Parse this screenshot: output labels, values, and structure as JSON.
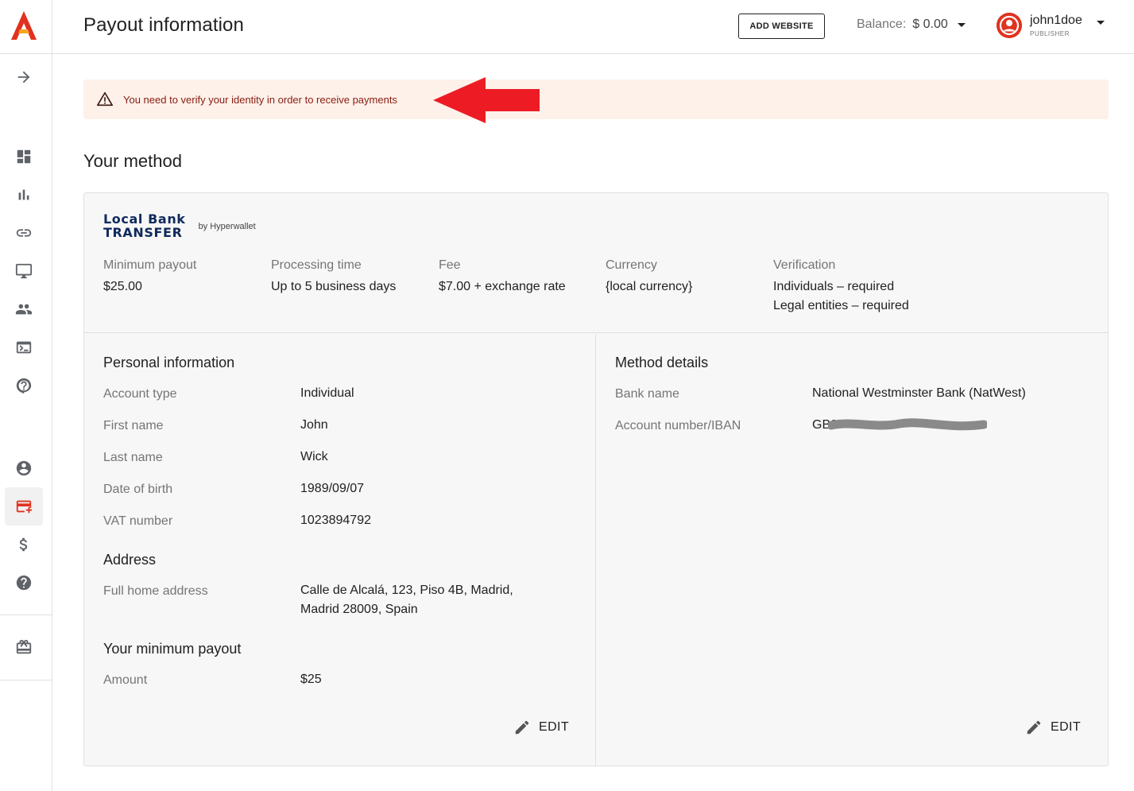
{
  "header": {
    "title": "Payout information",
    "add_website": "ADD WEBSITE",
    "balance_label": "Balance:",
    "balance_value": "$ 0.00",
    "username": "john1doe",
    "role": "PUBLISHER"
  },
  "sidebar": {
    "items": [
      {
        "name": "expand-arrow-icon"
      },
      {
        "name": "dashboard-icon"
      },
      {
        "name": "bar-chart-icon"
      },
      {
        "name": "link-icon"
      },
      {
        "name": "monitor-icon"
      },
      {
        "name": "people-icon"
      },
      {
        "name": "terminal-icon"
      },
      {
        "name": "help-bubble-icon"
      },
      {
        "name": "account-circle-icon"
      },
      {
        "name": "payment-card-icon",
        "active": true
      },
      {
        "name": "dollar-icon"
      },
      {
        "name": "help-icon"
      },
      {
        "name": "gift-icon"
      }
    ]
  },
  "alert": {
    "text": "You need to verify your identity in order to receive payments",
    "arrow_color": "#ed1c24"
  },
  "method": {
    "section_title": "Your method",
    "brand_line1": "Local Bank",
    "brand_line2": "TRANSFER",
    "brand_by": "by Hyperwallet",
    "stats": [
      {
        "label": "Minimum payout",
        "value": "$25.00"
      },
      {
        "label": "Processing time",
        "value": "Up to 5 business days"
      },
      {
        "label": "Fee",
        "value": "$7.00 + exchange rate"
      },
      {
        "label": "Currency",
        "value": "{local currency}"
      },
      {
        "label": "Verification",
        "value": "Individuals – required",
        "value2": "Legal entities – required"
      }
    ]
  },
  "personal": {
    "title": "Personal information",
    "rows": [
      {
        "label": "Account type",
        "value": "Individual"
      },
      {
        "label": "First name",
        "value": "John"
      },
      {
        "label": "Last name",
        "value": "Wick"
      },
      {
        "label": "Date of birth",
        "value": "1989/09/07"
      },
      {
        "label": "VAT number",
        "value": "1023894792"
      }
    ],
    "address_title": "Address",
    "address_label": "Full home address",
    "address_line1": "Calle de Alcalá, 123, Piso 4B, Madrid,",
    "address_line2": "Madrid 28009, Spain",
    "min_title": "Your minimum payout",
    "amount_label": "Amount",
    "amount_value": "$25",
    "edit": "EDIT"
  },
  "details": {
    "title": "Method details",
    "rows": [
      {
        "label": "Bank name",
        "value": "National Westminster Bank (NatWest)"
      },
      {
        "label": "Account number/IBAN",
        "value": "GB2"
      }
    ],
    "edit": "EDIT"
  },
  "colors": {
    "brand_red": "#e0321f",
    "alert_bg": "#fdf1ea",
    "alert_text": "#8a1c0f",
    "brand_navy": "#0f2a5c"
  }
}
